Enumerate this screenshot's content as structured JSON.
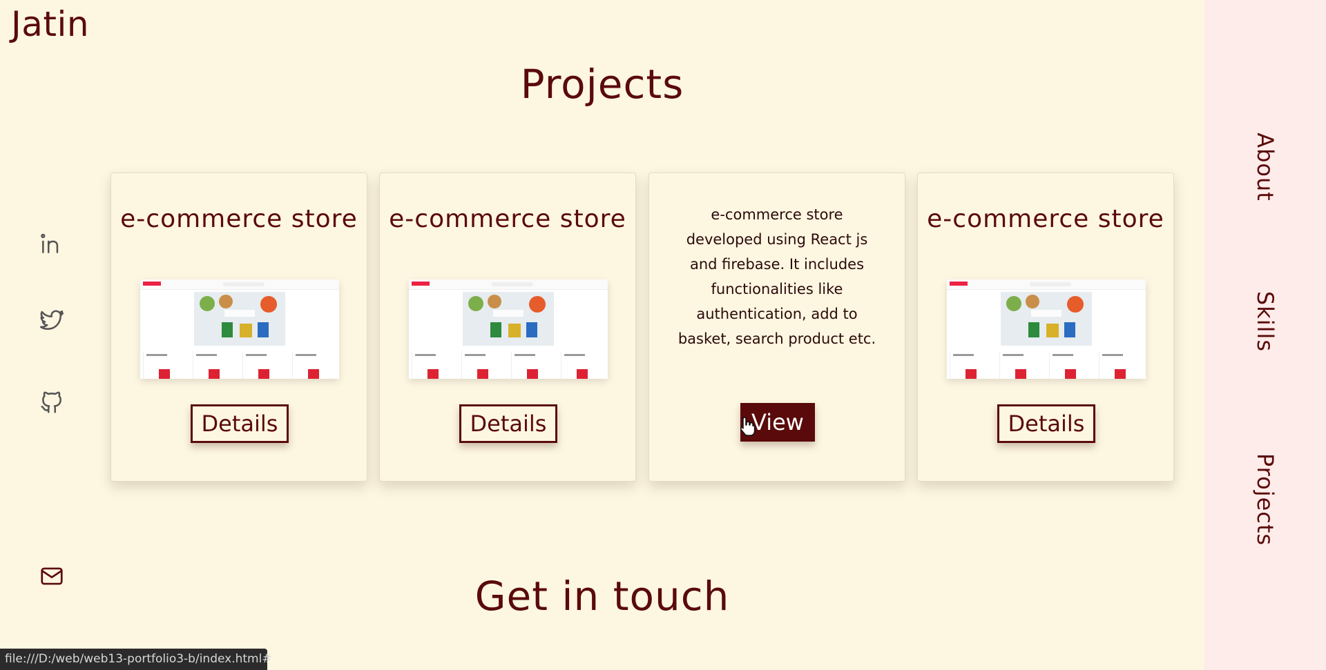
{
  "brand": "Jatin",
  "sections": {
    "projects_title": "Projects",
    "contact_title": "Get in touch"
  },
  "social": [
    {
      "name": "linkedin",
      "icon": "linkedin-icon"
    },
    {
      "name": "twitter",
      "icon": "twitter-icon"
    },
    {
      "name": "github",
      "icon": "github-icon"
    },
    {
      "name": "email",
      "icon": "mail-icon"
    }
  ],
  "nav": {
    "about": "About",
    "skills": "Skills",
    "projects": "Projects"
  },
  "cards": [
    {
      "title": "e-commerce store",
      "button": "Details"
    },
    {
      "title": "e-commerce store",
      "button": "Details"
    },
    {
      "description": "e-commerce store developed using React js and firebase. It includes functionalities like authentication, add to basket, search product etc.",
      "button": "View"
    },
    {
      "title": "e-commerce store",
      "button": "Details"
    }
  ],
  "statusbar": "file:///D:/web/web13-portfolio3-b/index.html#",
  "colors": {
    "background": "#fdf6e1",
    "accent": "#5a0a0a",
    "nav_panel": "#feecea"
  }
}
